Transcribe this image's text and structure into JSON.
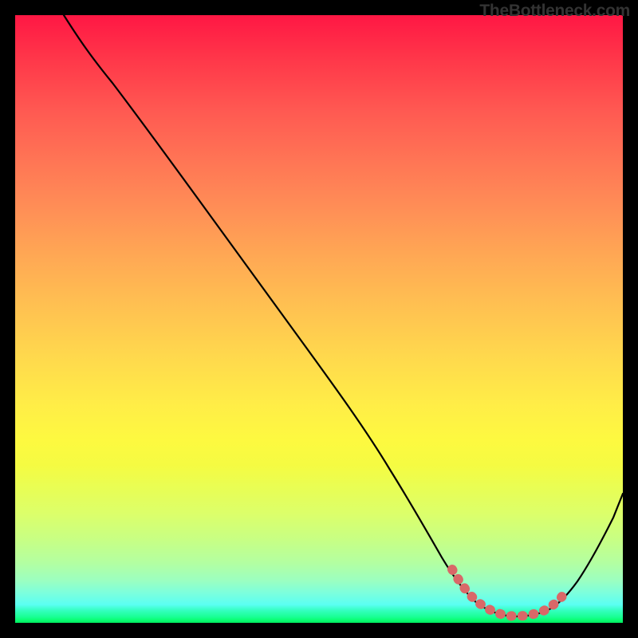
{
  "watermark": "TheBottleneck.com",
  "chart_data": {
    "type": "line",
    "title": "",
    "xlabel": "",
    "ylabel": "",
    "xlim": [
      0,
      100
    ],
    "ylim": [
      0,
      100
    ],
    "series": [
      {
        "name": "curve",
        "x": [
          8,
          12,
          16,
          20,
          25,
          30,
          35,
          40,
          45,
          50,
          55,
          60,
          63,
          66,
          68,
          70,
          73,
          76,
          79,
          82,
          85,
          87,
          89,
          92,
          95,
          98,
          100
        ],
        "y": [
          100,
          97,
          93,
          89,
          83,
          76,
          70,
          63,
          56,
          49,
          42,
          34,
          29,
          23,
          18,
          14,
          9,
          5,
          3,
          2,
          2,
          2,
          3,
          6,
          13,
          22,
          30
        ]
      },
      {
        "name": "bottleneck-marker",
        "type": "line",
        "color": "#d96868",
        "stroke_width": 9,
        "x": [
          72,
          74,
          76,
          78,
          80,
          82,
          84,
          86,
          88,
          90
        ],
        "y": [
          10,
          6,
          4,
          3,
          2.5,
          2.3,
          2.3,
          2.6,
          3.5,
          5.5
        ]
      }
    ]
  }
}
